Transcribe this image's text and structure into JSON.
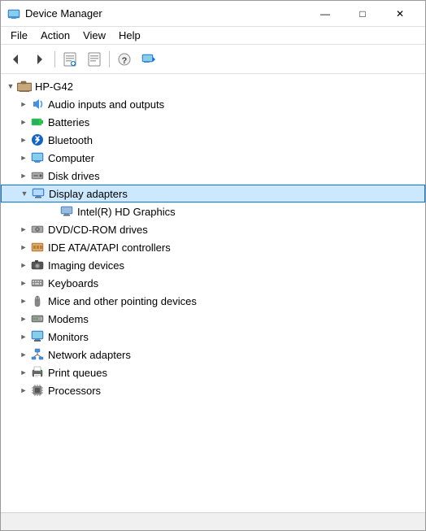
{
  "window": {
    "title": "Device Manager",
    "title_icon": "🖥",
    "controls": {
      "minimize": "—",
      "maximize": "□",
      "close": "✕"
    }
  },
  "menu": {
    "items": [
      {
        "label": "File"
      },
      {
        "label": "Action"
      },
      {
        "label": "View"
      },
      {
        "label": "Help"
      }
    ]
  },
  "toolbar": {
    "buttons": [
      {
        "name": "back-btn",
        "icon": "◀"
      },
      {
        "name": "forward-btn",
        "icon": "▶"
      },
      {
        "name": "prop-btn",
        "icon": "📋"
      },
      {
        "name": "update-btn",
        "icon": "🔄"
      },
      {
        "name": "help-btn",
        "icon": "❓"
      },
      {
        "name": "scan-btn",
        "icon": "🖥"
      }
    ]
  },
  "tree": {
    "root": {
      "label": "HP-G42",
      "expanded": true
    },
    "items": [
      {
        "id": "audio",
        "label": "Audio inputs and outputs",
        "indent": 1,
        "hasChildren": true,
        "expanded": false,
        "icon": "audio"
      },
      {
        "id": "batteries",
        "label": "Batteries",
        "indent": 1,
        "hasChildren": true,
        "expanded": false,
        "icon": "battery"
      },
      {
        "id": "bluetooth",
        "label": "Bluetooth",
        "indent": 1,
        "hasChildren": true,
        "expanded": false,
        "icon": "bluetooth"
      },
      {
        "id": "computer",
        "label": "Computer",
        "indent": 1,
        "hasChildren": true,
        "expanded": false,
        "icon": "computer"
      },
      {
        "id": "disk",
        "label": "Disk drives",
        "indent": 1,
        "hasChildren": true,
        "expanded": false,
        "icon": "disk"
      },
      {
        "id": "display",
        "label": "Display adapters",
        "indent": 1,
        "hasChildren": true,
        "expanded": true,
        "icon": "display",
        "selected": true
      },
      {
        "id": "intel",
        "label": "Intel(R) HD Graphics",
        "indent": 2,
        "hasChildren": false,
        "expanded": false,
        "icon": "intel"
      },
      {
        "id": "dvd",
        "label": "DVD/CD-ROM drives",
        "indent": 1,
        "hasChildren": true,
        "expanded": false,
        "icon": "dvd"
      },
      {
        "id": "ide",
        "label": "IDE ATA/ATAPI controllers",
        "indent": 1,
        "hasChildren": true,
        "expanded": false,
        "icon": "ide"
      },
      {
        "id": "imaging",
        "label": "Imaging devices",
        "indent": 1,
        "hasChildren": true,
        "expanded": false,
        "icon": "imaging"
      },
      {
        "id": "keyboards",
        "label": "Keyboards",
        "indent": 1,
        "hasChildren": true,
        "expanded": false,
        "icon": "keyboard"
      },
      {
        "id": "mice",
        "label": "Mice and other pointing devices",
        "indent": 1,
        "hasChildren": true,
        "expanded": false,
        "icon": "mouse"
      },
      {
        "id": "modems",
        "label": "Modems",
        "indent": 1,
        "hasChildren": true,
        "expanded": false,
        "icon": "modem"
      },
      {
        "id": "monitors",
        "label": "Monitors",
        "indent": 1,
        "hasChildren": true,
        "expanded": false,
        "icon": "monitor"
      },
      {
        "id": "network",
        "label": "Network adapters",
        "indent": 1,
        "hasChildren": true,
        "expanded": false,
        "icon": "network"
      },
      {
        "id": "print",
        "label": "Print queues",
        "indent": 1,
        "hasChildren": true,
        "expanded": false,
        "icon": "print"
      },
      {
        "id": "processors",
        "label": "Processors",
        "indent": 1,
        "hasChildren": true,
        "expanded": false,
        "icon": "processor"
      }
    ]
  },
  "status": {
    "text": ""
  }
}
